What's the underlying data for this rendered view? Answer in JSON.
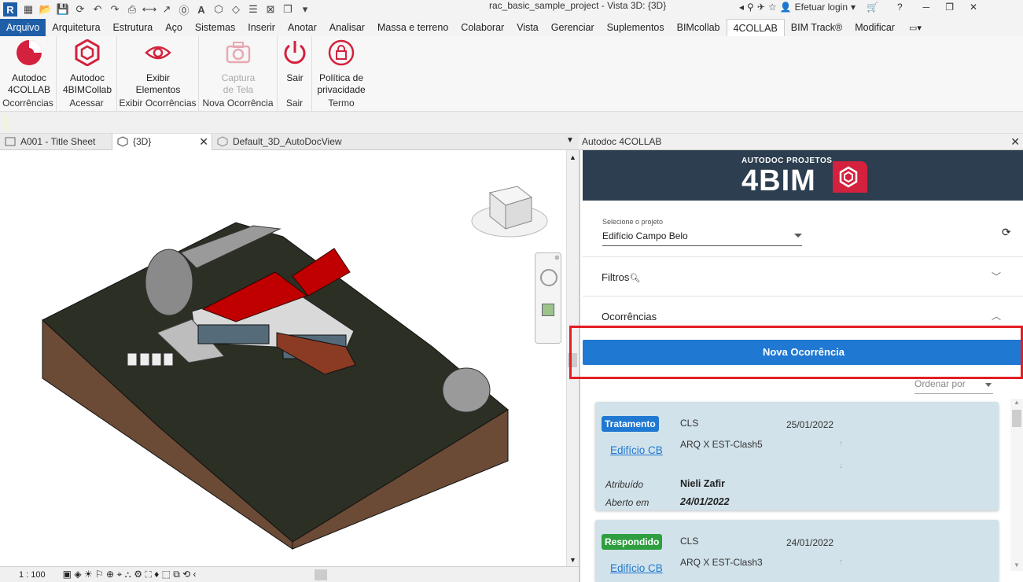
{
  "window": {
    "title": "rac_basic_sample_project - Vista 3D: {3D}",
    "login": "Efetuar login"
  },
  "tabs": [
    "Arquivo",
    "Arquitetura",
    "Estrutura",
    "Aço",
    "Sistemas",
    "Inserir",
    "Anotar",
    "Analisar",
    "Massa e terreno",
    "Colaborar",
    "Vista",
    "Gerenciar",
    "Suplementos",
    "BIMcollab",
    "4COLLAB",
    "BIM Track®",
    "Modificar"
  ],
  "ribbon": {
    "b1": "Autodoc",
    "b1b": "4COLLAB",
    "p1": "Ocorrências",
    "b2": "Autodoc",
    "b2b": "4BIMCollab",
    "p2": "Acessar",
    "b3": "Exibir",
    "b3b": "Elementos",
    "p3": "Exibir Ocorrências",
    "b4": "Captura",
    "b4b": "de Tela",
    "p4": "Nova Ocorrência",
    "b5": "Sair",
    "p5": "Sair",
    "b6": "Política de",
    "b6b": "privacidade",
    "p6": "Termo"
  },
  "views": {
    "v1": "A001 - Title Sheet",
    "v2": "{3D}",
    "v3": "Default_3D_AutoDocView"
  },
  "scale": "1 : 100",
  "pane": {
    "title": "Autodoc 4COLLAB",
    "brand_small": "AUTODOC PROJETOS",
    "brand_big": "4BIM",
    "project_label": "Selecione o projeto",
    "project_value": "Edifício Campo Belo",
    "filtros": "Filtros",
    "ocorrencias": "Ocorrências",
    "nova": "Nova Ocorrência",
    "ordenar": "Ordenar por"
  },
  "cards": [
    {
      "status": "Tratamento",
      "status_color": "#1f78d1",
      "type": "CLS",
      "date": "25/01/2022",
      "project": "Edifício CB",
      "name": "ARQ X EST-Clash5",
      "assigned_label": "Atribuído",
      "assigned": "Nieli Zafir",
      "opened_label": "Aberto em",
      "opened": "24/01/2022"
    },
    {
      "status": "Respondido",
      "status_color": "#2e9e3f",
      "type": "CLS",
      "date": "24/01/2022",
      "project": "Edifício CB",
      "name": "ARQ X EST-Clash3"
    }
  ],
  "colors": {
    "accent": "#1f78d1",
    "brand_red": "#d4213d",
    "highlight": "#e31e24",
    "banner": "#2d3e50"
  }
}
